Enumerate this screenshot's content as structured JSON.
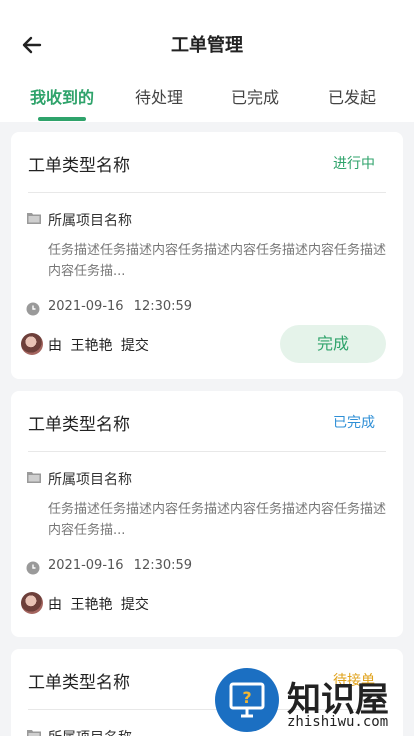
{
  "header": {
    "title": "工单管理"
  },
  "tabs": [
    {
      "label": "我收到的",
      "active": true
    },
    {
      "label": "待处理",
      "active": false
    },
    {
      "label": "已完成",
      "active": false
    },
    {
      "label": "已发起",
      "active": false
    }
  ],
  "cards": [
    {
      "type_name": "工单类型名称",
      "status": "进行中",
      "status_color": "#2fa36b",
      "project_name": "所属项目名称",
      "description": "任务描述任务描述内容任务描述内容任务描述内容任务描述内容任务描...",
      "datetime": "2021-09-16 12:30:59",
      "submitter_text": "由 王艳艳 提交",
      "action_label": "完成"
    },
    {
      "type_name": "工单类型名称",
      "status": "已完成",
      "status_color": "#2f8fd6",
      "project_name": "所属项目名称",
      "description": "任务描述任务描述内容任务描述内容任务描述内容任务描述内容任务描...",
      "datetime": "2021-09-16 12:30:59",
      "submitter_text": "由 王艳艳 提交"
    },
    {
      "type_name": "工单类型名称",
      "status": "待接单",
      "status_color": "#e0a21a",
      "project_name": "所属项目名称"
    }
  ],
  "watermark": {
    "brand": "知识屋",
    "url": "zhishiwu.com"
  },
  "colors": {
    "accent": "#2fa36b",
    "background": "#f3f4f6"
  }
}
